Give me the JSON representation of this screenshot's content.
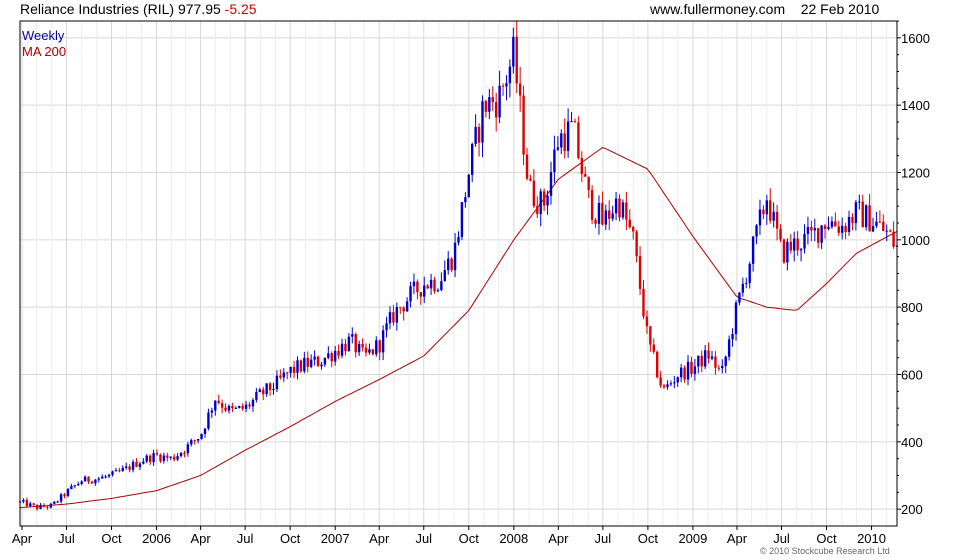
{
  "header": {
    "instrument": "Reliance Industries (RIL)",
    "last_price": "977.95",
    "change": "-5.25",
    "site": "www.fullermoney.com",
    "date": "22 Feb 2010"
  },
  "footer": {
    "copyright": "© 2010 Stockcube Research Ltd"
  },
  "colors": {
    "up": "#0000cc",
    "down": "#dd0000",
    "ma": "#aa0000",
    "grid": "#d8d8d8",
    "axis": "#000000"
  },
  "chart_data": {
    "type": "candlestick",
    "frequency_label": "Weekly",
    "ma_label": "MA 200",
    "y_ticks": [
      200,
      400,
      600,
      800,
      1000,
      1200,
      1400,
      1600
    ],
    "ylim": [
      150,
      1650
    ],
    "y_scale": "linear",
    "x_ticks": [
      "Apr",
      "Jul",
      "Oct",
      "2006",
      "Apr",
      "Jul",
      "Oct",
      "2007",
      "Apr",
      "Jul",
      "Oct",
      "2008",
      "Apr",
      "Jul",
      "Oct",
      "2009",
      "Apr",
      "Jul",
      "Oct",
      "2010"
    ],
    "x_range": [
      "2005-03-28",
      "2010-02-22"
    ],
    "grid": true,
    "close_anchors": [
      [
        "2005-04-01",
        220
      ],
      [
        "2005-05-01",
        205
      ],
      [
        "2005-06-01",
        210
      ],
      [
        "2005-07-01",
        250
      ],
      [
        "2005-08-01",
        285
      ],
      [
        "2005-09-01",
        290
      ],
      [
        "2005-10-01",
        300
      ],
      [
        "2005-11-01",
        320
      ],
      [
        "2005-12-01",
        345
      ],
      [
        "2006-01-01",
        360
      ],
      [
        "2006-02-01",
        350
      ],
      [
        "2006-03-01",
        380
      ],
      [
        "2006-04-01",
        420
      ],
      [
        "2006-05-01",
        530
      ],
      [
        "2006-06-01",
        490
      ],
      [
        "2006-07-01",
        500
      ],
      [
        "2006-08-01",
        540
      ],
      [
        "2006-09-01",
        570
      ],
      [
        "2006-10-01",
        610
      ],
      [
        "2006-11-01",
        630
      ],
      [
        "2006-12-01",
        640
      ],
      [
        "2007-01-01",
        670
      ],
      [
        "2007-02-01",
        700
      ],
      [
        "2007-03-01",
        650
      ],
      [
        "2007-04-01",
        690
      ],
      [
        "2007-05-01",
        780
      ],
      [
        "2007-06-01",
        830
      ],
      [
        "2007-07-01",
        870
      ],
      [
        "2007-08-01",
        880
      ],
      [
        "2007-09-01",
        960
      ],
      [
        "2007-10-01",
        1200
      ],
      [
        "2007-11-01",
        1400
      ],
      [
        "2007-12-01",
        1420
      ],
      [
        "2008-01-01",
        1550
      ],
      [
        "2008-02-01",
        1150
      ],
      [
        "2008-03-01",
        1100
      ],
      [
        "2008-04-01",
        1300
      ],
      [
        "2008-05-01",
        1330
      ],
      [
        "2008-06-01",
        1120
      ],
      [
        "2008-07-01",
        1050
      ],
      [
        "2008-08-01",
        1120
      ],
      [
        "2008-09-01",
        1000
      ],
      [
        "2008-10-01",
        700
      ],
      [
        "2008-11-01",
        550
      ],
      [
        "2008-12-01",
        600
      ],
      [
        "2009-01-01",
        620
      ],
      [
        "2009-02-01",
        660
      ],
      [
        "2009-03-01",
        600
      ],
      [
        "2009-04-01",
        800
      ],
      [
        "2009-05-01",
        960
      ],
      [
        "2009-06-01",
        1130
      ],
      [
        "2009-07-01",
        960
      ],
      [
        "2009-08-01",
        990
      ],
      [
        "2009-09-01",
        1010
      ],
      [
        "2009-10-01",
        1060
      ],
      [
        "2009-11-01",
        1040
      ],
      [
        "2009-12-01",
        1080
      ],
      [
        "2010-01-01",
        1060
      ],
      [
        "2010-02-01",
        1020
      ],
      [
        "2010-02-22",
        978
      ]
    ],
    "ma_anchors": [
      [
        "2005-04-01",
        205
      ],
      [
        "2005-07-01",
        215
      ],
      [
        "2005-10-01",
        232
      ],
      [
        "2006-01-01",
        255
      ],
      [
        "2006-04-01",
        300
      ],
      [
        "2006-07-01",
        375
      ],
      [
        "2006-10-01",
        445
      ],
      [
        "2007-01-01",
        520
      ],
      [
        "2007-04-01",
        585
      ],
      [
        "2007-07-01",
        655
      ],
      [
        "2007-10-01",
        790
      ],
      [
        "2008-01-01",
        1000
      ],
      [
        "2008-04-01",
        1180
      ],
      [
        "2008-07-01",
        1275
      ],
      [
        "2008-10-01",
        1210
      ],
      [
        "2009-01-01",
        1010
      ],
      [
        "2009-04-01",
        830
      ],
      [
        "2009-06-01",
        800
      ],
      [
        "2009-08-01",
        790
      ],
      [
        "2009-10-01",
        870
      ],
      [
        "2009-12-01",
        960
      ],
      [
        "2010-02-22",
        1025
      ]
    ]
  }
}
